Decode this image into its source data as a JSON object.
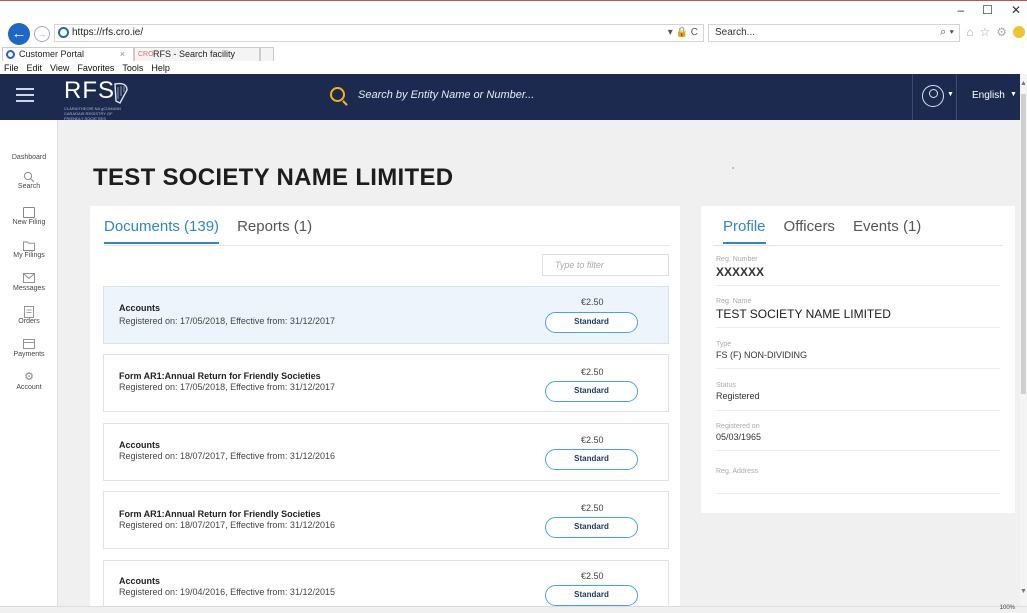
{
  "browser": {
    "url": "https://rfs.cro.ie/",
    "search_placeholder": "Search...",
    "tabs": [
      {
        "label": "Customer Portal",
        "close": "×"
      },
      {
        "label": "RFS - Search facility",
        "favicon": "CRO"
      }
    ],
    "menu": [
      "File",
      "Edit",
      "View",
      "Favorites",
      "Tools",
      "Help"
    ],
    "zoom": "100%"
  },
  "header": {
    "logo_text": "RFS",
    "logo_tagline": "CLÁRAITHEOIR NA gCUMANN CARADAIS REGISTRY OF FRIENDLY SOCIETIES",
    "search_placeholder": "Search by Entity Name or Number...",
    "language": "English"
  },
  "sidebar": {
    "items": [
      {
        "label": "Dashboard",
        "icon": "dashboard-icon"
      },
      {
        "label": "Search",
        "icon": "search-icon"
      },
      {
        "label": "New Filing",
        "icon": "new-filing-icon"
      },
      {
        "label": "My Filings",
        "icon": "folder-icon"
      },
      {
        "label": "Messages",
        "icon": "envelope-icon"
      },
      {
        "label": "Orders",
        "icon": "orders-icon"
      },
      {
        "label": "Payments",
        "icon": "card-icon"
      },
      {
        "label": "Account",
        "icon": "gear-icon"
      }
    ]
  },
  "main": {
    "title": "TEST SOCIETY NAME LIMITED",
    "docs_tabs": [
      {
        "label": "Documents (139)",
        "active": true
      },
      {
        "label": "Reports (1)",
        "active": false
      }
    ],
    "filter_placeholder": "Type to filter",
    "documents": [
      {
        "name": "Accounts",
        "sub": "Registered on: 17/05/2018, Effective from: 31/12/2017",
        "price": "€2.50",
        "button": "Standard",
        "selected": true
      },
      {
        "name": "Form AR1:Annual Return for Friendly Societies",
        "sub": "Registered on: 17/05/2018, Effective from: 31/12/2017",
        "price": "€2.50",
        "button": "Standard",
        "selected": false
      },
      {
        "name": "Accounts",
        "sub": "Registered on: 18/07/2017, Effective from: 31/12/2016",
        "price": "€2.50",
        "button": "Standard",
        "selected": false
      },
      {
        "name": "Form AR1:Annual Return for Friendly Societies",
        "sub": "Registered on: 18/07/2017, Effective from: 31/12/2016",
        "price": "€2.50",
        "button": "Standard",
        "selected": false
      },
      {
        "name": "Accounts",
        "sub": "Registered on: 19/04/2016, Effective from: 31/12/2015",
        "price": "€2.50",
        "button": "Standard",
        "selected": false
      }
    ],
    "profile_tabs": [
      {
        "label": "Profile",
        "active": true
      },
      {
        "label": "Officers",
        "active": false
      },
      {
        "label": "Events (1)",
        "active": false
      }
    ],
    "profile": [
      {
        "label": "Reg. Number",
        "value": "XXXXXX"
      },
      {
        "label": "Reg. Name",
        "value": "TEST SOCIETY NAME LIMITED"
      },
      {
        "label": "Type",
        "value": "FS (F) NON-DIVIDING"
      },
      {
        "label": "Status",
        "value": "Registered"
      },
      {
        "label": "Registered on",
        "value": "05/03/1965"
      },
      {
        "label": "Reg. Address",
        "value": ""
      }
    ]
  },
  "colors": {
    "header_bg": "#1b2a4e",
    "accent": "#2f86c8",
    "search_icon": "#f2b61b",
    "selected_row": "#eef4fb"
  }
}
